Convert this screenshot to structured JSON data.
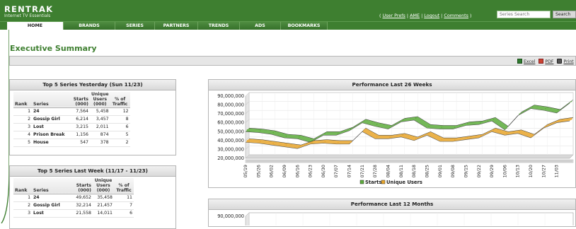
{
  "header": {
    "logo": "RENTRAK",
    "logo_sub": "Internet TV Essentials",
    "links_open": "( ",
    "links": [
      "User Prefs",
      "AME",
      "Logout",
      "Comments"
    ],
    "link_sep": " | ",
    "links_close": " )",
    "search_placeholder": "Series Search",
    "search_button": "Search"
  },
  "nav": {
    "tabs": [
      {
        "label": "HOME",
        "active": true
      },
      {
        "label": "BRANDS"
      },
      {
        "label": "SERIES"
      },
      {
        "label": "PARTNERS"
      },
      {
        "label": "TRENDS"
      },
      {
        "label": "ADS"
      },
      {
        "label": "BOOKMARKS"
      }
    ]
  },
  "page": {
    "title": "Executive Summary",
    "export": {
      "excel": "Excel",
      "pdf": "PDF",
      "print": "Print"
    }
  },
  "yesterday": {
    "title": "Top 5 Series Yesterday (Sun 11/23)",
    "columns": {
      "rank": "Rank",
      "series": "Series",
      "starts": [
        "Starts",
        "(000)"
      ],
      "unique": [
        "Unique",
        "Users",
        "(000)"
      ],
      "traffic": [
        "% of",
        "Traffic"
      ]
    },
    "rows": [
      [
        "1",
        "24",
        "7,564",
        "5,458",
        "12"
      ],
      [
        "2",
        "Gossip Girl",
        "6,214",
        "3,457",
        "8"
      ],
      [
        "3",
        "Lost",
        "3,215",
        "2,011",
        "6"
      ],
      [
        "4",
        "Prison Break",
        "1,156",
        "874",
        "5"
      ],
      [
        "5",
        "House",
        "547",
        "378",
        "2"
      ]
    ]
  },
  "lastweek": {
    "title": "Top 5 Series Last Week (11/17 - 11/23)",
    "columns": {
      "rank": "Rank",
      "series": "Series",
      "starts": [
        "Starts",
        "(000)"
      ],
      "unique": [
        "Unique",
        "Users",
        "(000)"
      ],
      "traffic": [
        "% of",
        "Traffic"
      ]
    },
    "rows": [
      [
        "1",
        "24",
        "49,652",
        "35,458",
        "11"
      ],
      [
        "2",
        "Gossip Girl",
        "32,214",
        "21,457",
        "7"
      ],
      [
        "3",
        "Lost",
        "21,558",
        "14,011",
        "6"
      ]
    ]
  },
  "chart_data": [
    {
      "type": "line",
      "title": "Performance Last 26 Weeks",
      "x": [
        "05/19",
        "05/26",
        "06/02",
        "06/09",
        "06/16",
        "06/23",
        "06/30",
        "07/07",
        "07/14",
        "07/21",
        "07/28",
        "08/04",
        "08/11",
        "08/18",
        "08/25",
        "09/01",
        "09/08",
        "09/15",
        "09/22",
        "09/29",
        "10/06",
        "10/13",
        "10/20",
        "10/27",
        "11/03",
        "11/10"
      ],
      "x_labels_shown": [
        "05/19",
        "05/26",
        "06/02",
        "06/09",
        "06/16",
        "06/23",
        "06/30",
        "07/07",
        "07/14",
        "07/21",
        "07/28",
        "08/04",
        "08/11",
        "08/18",
        "08/25",
        "09/01",
        "09/08",
        "09/15",
        "09/22",
        "09/29",
        "10/06",
        "10/13",
        "10/20",
        "10/27",
        "11/03"
      ],
      "y_ticks": [
        "90,000,000",
        "80,000,000",
        "70,000,000",
        "60,000,000",
        "50,000,000",
        "40,000,000",
        "30,000,000",
        "20,000,000"
      ],
      "ylim": [
        20000000,
        90000000
      ],
      "grid": true,
      "legend_position": "bottom",
      "series": [
        {
          "name": "Starts",
          "color": "#5cab3b",
          "values": [
            50000000,
            49000000,
            47000000,
            43000000,
            42000000,
            38000000,
            46000000,
            46000000,
            51000000,
            60000000,
            56000000,
            53000000,
            61000000,
            63000000,
            54000000,
            53000000,
            53000000,
            57000000,
            58000000,
            62000000,
            52000000,
            68000000,
            76000000,
            74000000,
            71000000,
            82000000
          ]
        },
        {
          "name": "Unique Users",
          "color": "#e8a52a",
          "values": [
            38000000,
            37000000,
            35000000,
            33000000,
            31000000,
            36000000,
            37000000,
            36000000,
            36000000,
            50000000,
            42000000,
            42000000,
            44000000,
            40000000,
            46000000,
            39000000,
            39000000,
            41000000,
            43000000,
            50000000,
            46000000,
            48000000,
            43000000,
            54000000,
            60000000,
            62000000
          ]
        }
      ]
    },
    {
      "type": "line",
      "title": "Performance Last 12 Months",
      "y_ticks": [
        "90,000,000"
      ],
      "series": []
    }
  ]
}
